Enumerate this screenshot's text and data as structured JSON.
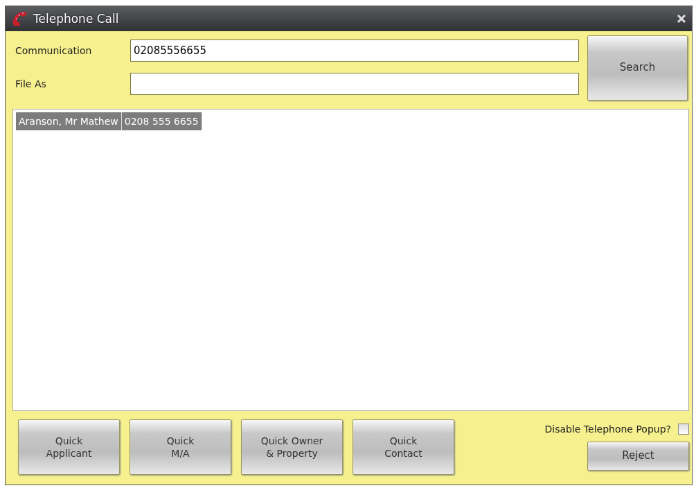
{
  "window": {
    "title": "Telephone Call"
  },
  "fields": [
    {
      "label": "Communication",
      "value": "02085556655"
    },
    {
      "label": "File As"
    }
  ],
  "search_button": "Search",
  "results": {
    "rows": [
      {
        "cells": [
          "Aranson, Mr Mathew",
          "0208 555 6655"
        ],
        "selected": true
      }
    ]
  },
  "quick_buttons": [
    {
      "lines": [
        "Quick",
        "Applicant"
      ]
    },
    {
      "lines": [
        "Quick",
        "M/A"
      ]
    },
    {
      "lines": [
        "Quick Owner",
        "& Property"
      ]
    },
    {
      "lines": [
        "Quick",
        "Contact"
      ]
    }
  ],
  "disable_popup": {
    "label": "Disable Telephone Popup?",
    "checked": false
  },
  "reject_button": "Reject"
}
